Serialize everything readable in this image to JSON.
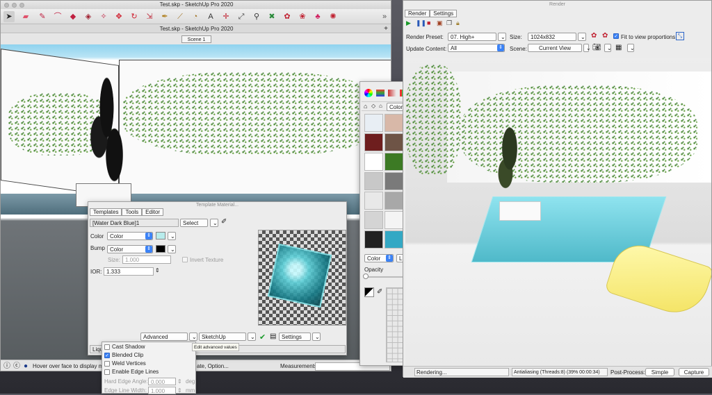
{
  "sketchup": {
    "app_title": "Test.skp - SketchUp Pro 2020",
    "doc_tab": "Test.skp - SketchUp Pro 2020",
    "scene_tab": "Scene 1",
    "status_text": "Hover over face to display ma",
    "status_text_tail": "ate, Option...",
    "measurements_label": "Measurements",
    "toolbar_icons": [
      "select-icon",
      "eraser-icon",
      "line-icon",
      "arc-icon",
      "shapes-icon",
      "push-pull-icon",
      "paint-icon",
      "move-icon",
      "rotate-icon",
      "scale-icon",
      "eyedropper-icon",
      "tape-icon",
      "protractor-icon",
      "text-icon",
      "axes-icon",
      "dimension-icon",
      "zoom-icon",
      "zoom-extents-icon",
      "orbit-icon",
      "render-icon",
      "warehouse-icon",
      "extension-icon",
      "more-icon"
    ]
  },
  "template_material": {
    "title": "Template Material...",
    "tabs": [
      "Templates",
      "Tools",
      "Editor"
    ],
    "material_name": "[Water Dark Blue]1",
    "select_label": "Select",
    "color_label": "Color",
    "color_mode": "Color",
    "bump_label": "Bump",
    "bump_mode": "Color",
    "size_label": "Size:",
    "size_value": "1.000",
    "invert_texture": "Invert Texture",
    "ior_label": "IOR:",
    "ior_value": "1.333",
    "advanced_label": "Advanced",
    "sketchup_label": "SketchUp",
    "settings_label": "Settings",
    "bottom_label": "Liqu",
    "color_swatch": "#b8ecec",
    "bump_swatch": "#000000"
  },
  "menu": {
    "items": [
      {
        "label": "Cast Shadow",
        "checked": false
      },
      {
        "label": "Blended Clip",
        "checked": true
      },
      {
        "label": "Weld Vertices",
        "checked": false
      },
      {
        "label": "Enable Edge Lines",
        "checked": false
      }
    ],
    "hard_edge_label": "Hard Edge Angle:",
    "hard_edge_value": "0.000",
    "hard_edge_unit": "deg",
    "edge_width_label": "Edge Line Width:",
    "edge_width_value": "1.000",
    "edge_width_unit": "mm",
    "tooltip": "Edit advanced values"
  },
  "colors": {
    "title": "Colors",
    "source": "Colors In Model",
    "mode": "Color",
    "view": "List",
    "opacity_label": "Opacity",
    "opacity_value": "0%",
    "swatches": [
      "#e8eef4",
      "#d8b8a8",
      "#2c4a5e",
      "#b83030",
      "#a06a4a",
      "#6e1e1e",
      "#6e5446",
      "#a08a64",
      "#727890",
      "#fff7a0",
      "#ffffff",
      "#3c7a24",
      "#8a4a30",
      "#9ab0bc",
      "#b8d8d8",
      "#c8c8c8",
      "#7a7a7a",
      "#8a7a6a",
      "#9a9080",
      "#6ab0bc",
      "#e8e8e8",
      "#a8a8a8",
      "#dcdcdc",
      "#c0c0c0",
      "#7a7a7a",
      "#d4d4d4",
      "#f4f4f4",
      "#4c8a34",
      "#40b4d0",
      "#111111",
      "#222222",
      "#34a8c4",
      "#58b8c8",
      "#c0e4ec",
      "#0a0a0a"
    ]
  },
  "render": {
    "title": "Render",
    "tabs": [
      "Render",
      "Settings"
    ],
    "preset_label": "Render Preset:",
    "preset_value": "07. High+",
    "size_label": "Size:",
    "size_value": "1024x832",
    "fit_label": "Fit to view proportions",
    "update_label": "Update Content:",
    "update_value": "All",
    "scene_label": "Scene:",
    "scene_value": "Current View",
    "status": "Rendering...",
    "antialias": "Antialiasing (Threads:8) (39% 00:00:34)",
    "postprocess_label": "Post-Process:",
    "simple_button": "Simple",
    "capture_button": "Capture"
  }
}
